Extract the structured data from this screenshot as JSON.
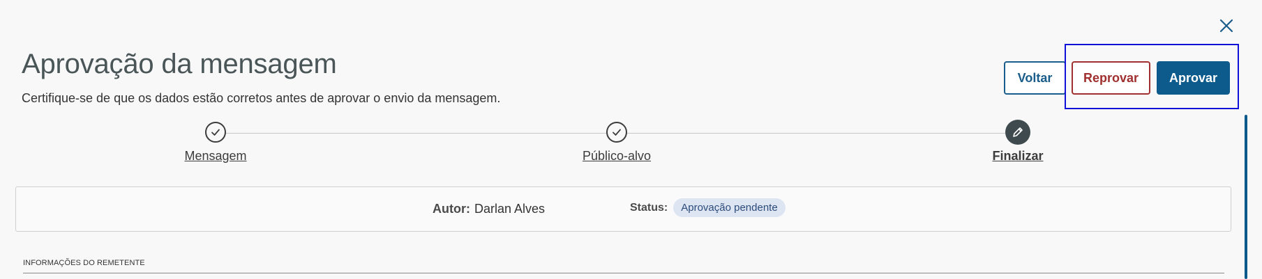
{
  "header": {
    "title": "Aprovação da mensagem",
    "subtitle": "Certifique-se de que os dados estão corretos antes de aprovar o envio da mensagem."
  },
  "actions": {
    "voltar_label": "Voltar",
    "reprovar_label": "Reprovar",
    "aprovar_label": "Aprovar"
  },
  "stepper": {
    "steps": [
      {
        "label": "Mensagem",
        "state": "done",
        "icon": "check-icon"
      },
      {
        "label": "Público-alvo",
        "state": "done",
        "icon": "check-icon"
      },
      {
        "label": "Finalizar",
        "state": "current",
        "icon": "pencil-icon"
      }
    ]
  },
  "info": {
    "autor_label": "Autor:",
    "autor_value": "Darlan Alves",
    "status_label": "Status:",
    "status_value": "Aprovação pendente"
  },
  "section": {
    "title": "INFORMAÇÕES DO REMETENTE"
  },
  "colors": {
    "primary": "#0d5a8c",
    "danger": "#a0302f",
    "badge_bg": "#dde5f3",
    "highlight": "#1010d8"
  },
  "icons": {
    "close": "close-icon"
  }
}
